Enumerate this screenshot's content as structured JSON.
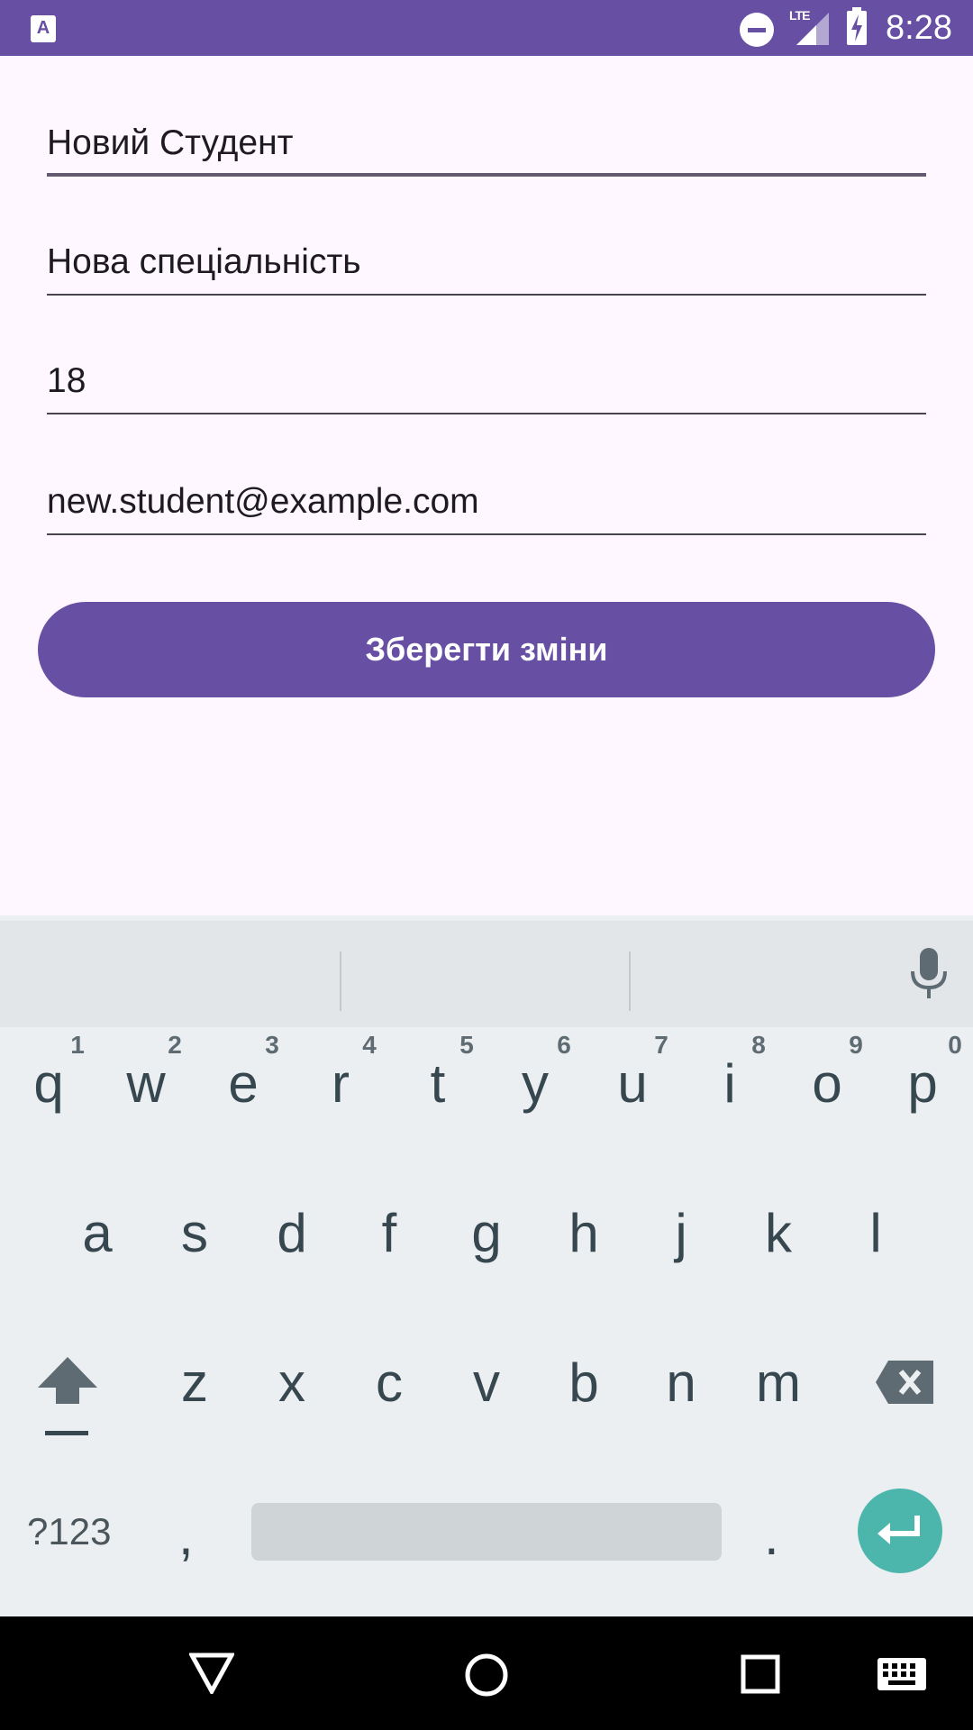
{
  "status_bar": {
    "time": "8:28",
    "network": "LTE",
    "colors": {
      "background": "#6750a4",
      "foreground": "#ffffff"
    },
    "icons": [
      "app-notification-icon",
      "do-not-disturb-icon",
      "signal-icon",
      "battery-charging-icon"
    ]
  },
  "form": {
    "name": "Новий Студент",
    "specialty": "Нова спеціальність",
    "age": "18",
    "email": "new.student@example.com"
  },
  "save_button": {
    "label": "Зберегти зміни",
    "color": "#6750a4"
  },
  "keyboard": {
    "row1": [
      {
        "key": "q",
        "hint": "1"
      },
      {
        "key": "w",
        "hint": "2"
      },
      {
        "key": "e",
        "hint": "3"
      },
      {
        "key": "r",
        "hint": "4"
      },
      {
        "key": "t",
        "hint": "5"
      },
      {
        "key": "y",
        "hint": "6"
      },
      {
        "key": "u",
        "hint": "7"
      },
      {
        "key": "i",
        "hint": "8"
      },
      {
        "key": "o",
        "hint": "9"
      },
      {
        "key": "p",
        "hint": "0"
      }
    ],
    "row2": [
      "a",
      "s",
      "d",
      "f",
      "g",
      "h",
      "j",
      "k",
      "l"
    ],
    "row3": [
      "z",
      "x",
      "c",
      "v",
      "b",
      "n",
      "m"
    ],
    "symbols_label": "?123",
    "comma": ",",
    "period": ".",
    "enter_color": "#4db6ac"
  },
  "nav_bar": {
    "icons": [
      "back-icon",
      "home-icon",
      "recents-icon",
      "keyboard-switch-icon"
    ]
  }
}
